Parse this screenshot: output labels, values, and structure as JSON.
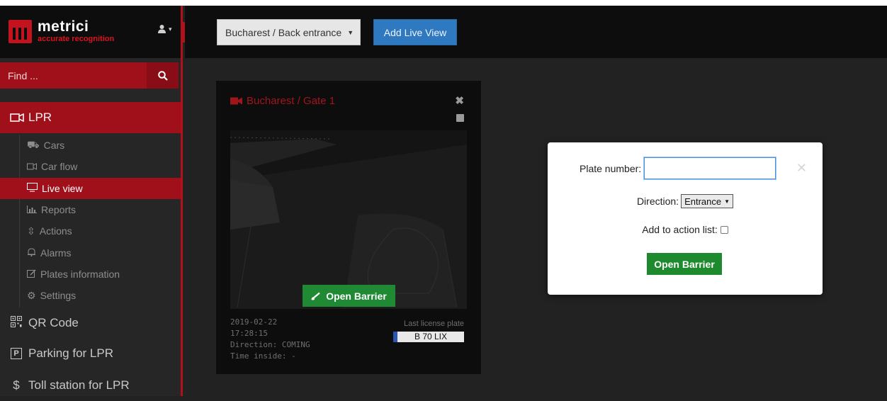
{
  "brand": {
    "name": "metrici",
    "tagline": "accurate recognition"
  },
  "icons": {
    "user": "user-icon",
    "collapse": "chevron-left-icon",
    "search": "search-icon"
  },
  "search": {
    "placeholder": "Find ..."
  },
  "nav": {
    "lpr": "LPR",
    "sub_items": [
      {
        "label": "Cars",
        "icon": "car-icon",
        "active": false
      },
      {
        "label": "Car flow",
        "icon": "video-icon",
        "active": false
      },
      {
        "label": "Live view",
        "icon": "monitor-icon",
        "active": true
      },
      {
        "label": "Reports",
        "icon": "bar-chart-icon",
        "active": false
      },
      {
        "label": "Actions",
        "icon": "arrows-icon",
        "active": false
      },
      {
        "label": "Alarms",
        "icon": "bell-icon",
        "active": false
      },
      {
        "label": "Plates information",
        "icon": "edit-icon",
        "active": false
      },
      {
        "label": "Settings",
        "icon": "gear-icon",
        "active": false
      }
    ],
    "qr": "QR Code",
    "parking": "Parking for LPR",
    "toll": "Toll station for LPR"
  },
  "topbar": {
    "location": "Bucharest / Back entrance",
    "add_live_view": "Add Live View"
  },
  "camera": {
    "title": "Bucharest / Gate 1",
    "open_barrier": "Open Barrier",
    "date": "2019-02-22",
    "time": "17:28:15",
    "direction": "Direction: COMING",
    "time_inside": "Time inside: -",
    "last_plate_label": "Last license plate",
    "last_plate": "B 70 LIX"
  },
  "modal": {
    "plate_label": "Plate number:",
    "plate_value": "",
    "direction_label": "Direction:",
    "direction_value": "Entrance",
    "action_list_label": "Add to action list:",
    "action_list_checked": false,
    "open_barrier": "Open Barrier"
  },
  "colors": {
    "accent_red": "#a0101a",
    "brand_red": "#c3131f",
    "primary_blue": "#2e79c0",
    "success_green": "#1f8a33"
  }
}
